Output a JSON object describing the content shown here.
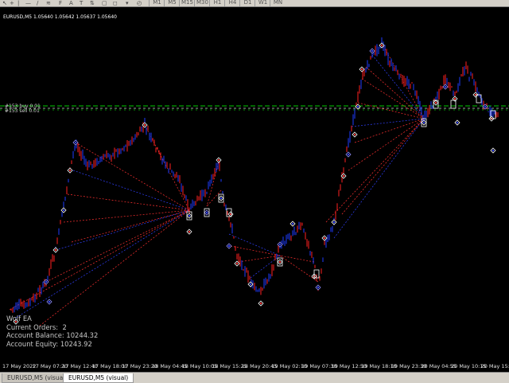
{
  "toolbar": {
    "cursor_icon": "pointer-arrow-icon",
    "timeframes": [
      "M1",
      "M5",
      "M15",
      "M30",
      "H1",
      "H4",
      "D1",
      "W1",
      "MN"
    ]
  },
  "chart": {
    "symbol_info": "EURUSD,M5  1.05640 1.05642 1.05637 1.05640",
    "hline_labels": [
      "#153 buy 0.01",
      "#153 sell 0.01"
    ],
    "colors": {
      "bull": "#1e3cff",
      "bear": "#ff2020",
      "buy_line": "#ff3030",
      "sell_line": "#3040ff",
      "level_green": "#00cc00",
      "level_dash": "#d0d0d0"
    }
  },
  "ea_panel": {
    "title": "Wolf EA",
    "orders_label": "Current Orders",
    "orders_value": "2",
    "balance_label": "Account Balance",
    "balance_value": "10244.32",
    "equity_label": "Account Equity",
    "equity_value": "10243.92"
  },
  "time_axis": [
    "17 May 2022",
    "17 May 07:20",
    "17 May 12:40",
    "17 May 18:00",
    "17 May 23:20",
    "18 May 04:45",
    "18 May 10:05",
    "18 May 15:25",
    "18 May 20:45",
    "19 May 02:10",
    "19 May 07:30",
    "19 May 12:50",
    "19 May 18:10",
    "19 May 23:30",
    "20 May 04:55",
    "20 May 10:15",
    "20 May 15:35"
  ],
  "tabs": [
    {
      "label": "EURUSD,M5 (visual)",
      "active": false
    },
    {
      "label": "EURUSD,M5 (visual)",
      "active": true
    }
  ]
}
